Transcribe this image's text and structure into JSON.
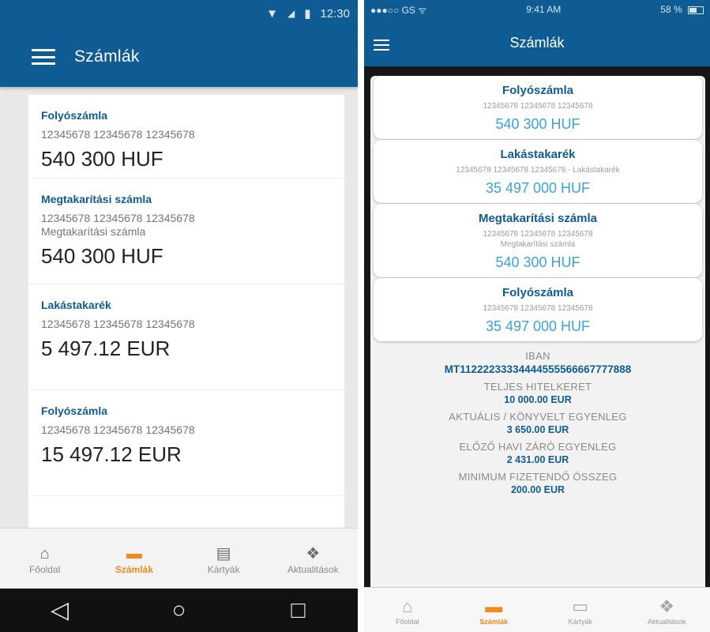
{
  "android": {
    "status": {
      "time": "12:30"
    },
    "appbar": {
      "title": "Számlák"
    },
    "accounts": [
      {
        "name": "Folyószámla",
        "number": "12345678 12345678 12345678",
        "subtitle": "",
        "amount": "540 300 HUF"
      },
      {
        "name": "Megtakarítási számla",
        "number": "12345678 12345678 12345678",
        "subtitle": "Megtakarítási számla",
        "amount": "540 300 HUF"
      },
      {
        "name": "Lakástakarék",
        "number": "12345678 12345678 12345678",
        "subtitle": "",
        "amount": "5 497.12 EUR"
      },
      {
        "name": "Folyószámla",
        "number": "12345678 12345678 12345678",
        "subtitle": "",
        "amount": "15 497.12 EUR"
      }
    ],
    "bottom_nav": [
      {
        "label": "Főoldal",
        "icon": "home-icon",
        "glyph": "⌂",
        "active": false
      },
      {
        "label": "Számlák",
        "icon": "wallet-icon",
        "glyph": "▬",
        "active": true
      },
      {
        "label": "Kártyák",
        "icon": "card-icon",
        "glyph": "▤",
        "active": false
      },
      {
        "label": "Aktualitások",
        "icon": "news-icon",
        "glyph": "❖",
        "active": false
      }
    ],
    "system_nav": {
      "back": "◁",
      "home": "○",
      "recents": "□"
    }
  },
  "ios": {
    "status": {
      "carrier": "●●●○○ GS ᯤ",
      "time": "9:41 AM",
      "battery": "58 %"
    },
    "navbar": {
      "title": "Számlák"
    },
    "accounts": [
      {
        "name": "Folyószámla",
        "number": "12345678 12345678 12345678",
        "subtitle": "",
        "amount": "540 300 HUF"
      },
      {
        "name": "Lakástakarék",
        "number": "12345678 12345678 12345678 - Lakástakarék",
        "subtitle": "",
        "amount": "35 497 000 HUF"
      },
      {
        "name": "Megtakarítási számla",
        "number": "12345678 12345678 12345678",
        "subtitle": "Megtakarítási számla",
        "amount": "540 300 HUF"
      },
      {
        "name": "Folyószámla",
        "number": "12345678 12345678 12345678",
        "subtitle": "",
        "amount": "35 497 000 HUF"
      }
    ],
    "details": [
      {
        "label": "IBAN",
        "value": "MT11222233334444555566667777888"
      },
      {
        "label": "TELJES HITELKERET",
        "value": "10 000.00 EUR"
      },
      {
        "label": "AKTUÁLIS / KÖNYVELT EGYENLEG",
        "value": "3 650.00 EUR"
      },
      {
        "label": "ELŐZŐ HAVI ZÁRÓ EGYENLEG",
        "value": "2 431.00 EUR"
      },
      {
        "label": "MINIMUM FIZETENDŐ ÖSSZEG",
        "value": "200.00 EUR"
      }
    ],
    "tabbar": [
      {
        "label": "Főoldal",
        "icon": "home-icon",
        "glyph": "⌂",
        "active": false
      },
      {
        "label": "Számlák",
        "icon": "wallet-icon",
        "glyph": "▬",
        "active": true
      },
      {
        "label": "Kártyák",
        "icon": "card-icon",
        "glyph": "▭",
        "active": false
      },
      {
        "label": "Aktualitások",
        "icon": "news-icon",
        "glyph": "❖",
        "active": false
      }
    ]
  },
  "colors": {
    "primary": "#0f5c95",
    "accent": "#f08a1c",
    "amount_ios": "#3aa3d9"
  }
}
